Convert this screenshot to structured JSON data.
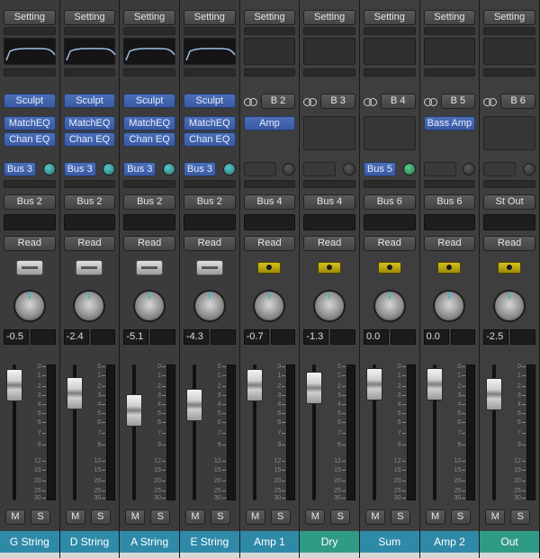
{
  "mixer": {
    "setting_label": "Setting",
    "read_label": "Read",
    "mute_label": "M",
    "solo_label": "S",
    "colors": {
      "strip_bg": "#3b3b3b",
      "blue_button": "#3f5fa8",
      "name_blue": "#2f8aa8",
      "name_teal": "#2f9a86",
      "aux_icon": "#cbb619"
    },
    "channels": [
      {
        "name": "G String",
        "kind": "instrument",
        "eq": "on",
        "plugins": [
          "Sculpt",
          "MatchEQ",
          "Chan EQ"
        ],
        "send": "Bus 3",
        "send_knob": "cyan",
        "output": "Bus 2",
        "pan_icon": "instrument-icon",
        "volume": "-0.5",
        "fader_db": -0.5,
        "name_color": "#2f8aa8"
      },
      {
        "name": "D String",
        "kind": "instrument",
        "eq": "on",
        "plugins": [
          "Sculpt",
          "MatchEQ",
          "Chan EQ"
        ],
        "send": "Bus 3",
        "send_knob": "cyan",
        "output": "Bus 2",
        "pan_icon": "instrument-icon",
        "volume": "-2.4",
        "fader_db": -2.4,
        "name_color": "#2f8aa8"
      },
      {
        "name": "A String",
        "kind": "instrument",
        "eq": "on",
        "plugins": [
          "Sculpt",
          "MatchEQ",
          "Chan EQ"
        ],
        "send": "Bus 3",
        "send_knob": "cyan",
        "output": "Bus 2",
        "pan_icon": "instrument-icon",
        "volume": "-5.1",
        "fader_db": -5.1,
        "name_color": "#2f8aa8"
      },
      {
        "name": "E String",
        "kind": "instrument",
        "eq": "on",
        "plugins": [
          "Sculpt",
          "MatchEQ",
          "Chan EQ"
        ],
        "send": "Bus 3",
        "send_knob": "cyan",
        "output": "Bus 2",
        "pan_icon": "instrument-icon",
        "volume": "-4.3",
        "fader_db": -4.3,
        "name_color": "#2f8aa8"
      },
      {
        "name": "Amp 1",
        "kind": "aux",
        "eq": "off",
        "input": "B 2",
        "plugins": [
          "Amp"
        ],
        "send": "",
        "send_knob": "none",
        "output": "Bus 4",
        "pan_icon": "aux-icon",
        "volume": "-0.7",
        "fader_db": -0.7,
        "name_color": "#2f8aa8"
      },
      {
        "name": "Dry",
        "kind": "aux",
        "eq": "off",
        "input": "B 3",
        "plugins": [],
        "send": "",
        "send_knob": "none",
        "output": "Bus 4",
        "pan_icon": "aux-icon",
        "volume": "-1.3",
        "fader_db": -1.3,
        "name_color": "#2f9a86"
      },
      {
        "name": "Sum",
        "kind": "aux",
        "eq": "off",
        "input": "B 4",
        "plugins": [],
        "send": "Bus 5",
        "send_knob": "green",
        "output": "Bus 6",
        "pan_icon": "aux-icon",
        "volume": "0.0",
        "fader_db": 0.0,
        "name_color": "#2f8aa8"
      },
      {
        "name": "Amp 2",
        "kind": "aux",
        "eq": "off",
        "input": "B 5",
        "plugins": [
          "Bass Amp"
        ],
        "send": "",
        "send_knob": "none",
        "output": "Bus 6",
        "pan_icon": "aux-icon",
        "volume": "0.0",
        "fader_db": 0.0,
        "name_color": "#2f8aa8"
      },
      {
        "name": "Out",
        "kind": "aux",
        "eq": "off",
        "input": "B 6",
        "plugins": [],
        "send": "",
        "send_knob": "none",
        "output": "St Out",
        "pan_icon": "aux-icon",
        "volume": "-2.5",
        "fader_db": -2.5,
        "name_color": "#2f9a86"
      }
    ],
    "scale_ticks": [
      "0",
      "1",
      "2",
      "3",
      "4",
      "5",
      "6",
      "7",
      "9",
      "12",
      "15",
      "20",
      "25",
      "30"
    ]
  }
}
